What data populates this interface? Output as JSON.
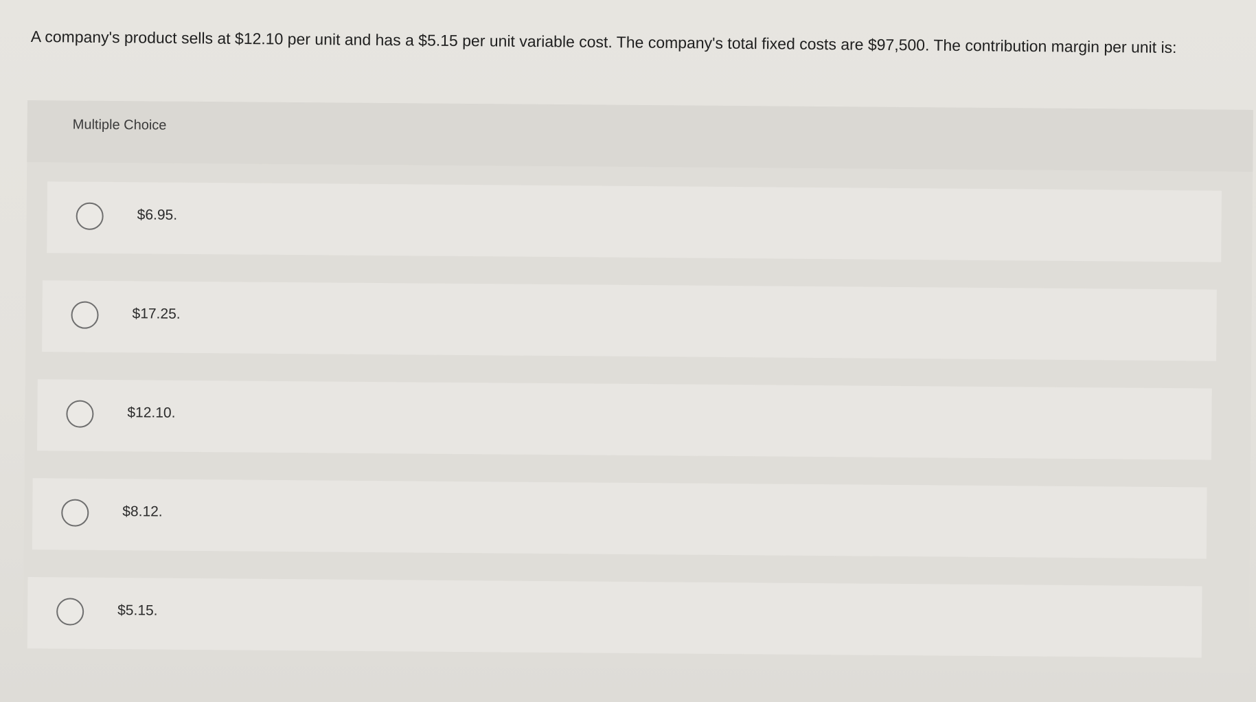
{
  "question": {
    "text": "A company's product sells at $12.10 per unit and has a $5.15 per unit variable cost. The company's total fixed costs are $97,500. The contribution margin per unit is:"
  },
  "panel": {
    "label": "Multiple Choice"
  },
  "options": [
    {
      "label": "$6.95."
    },
    {
      "label": "$17.25."
    },
    {
      "label": "$12.10."
    },
    {
      "label": "$8.12."
    },
    {
      "label": "$5.15."
    }
  ]
}
